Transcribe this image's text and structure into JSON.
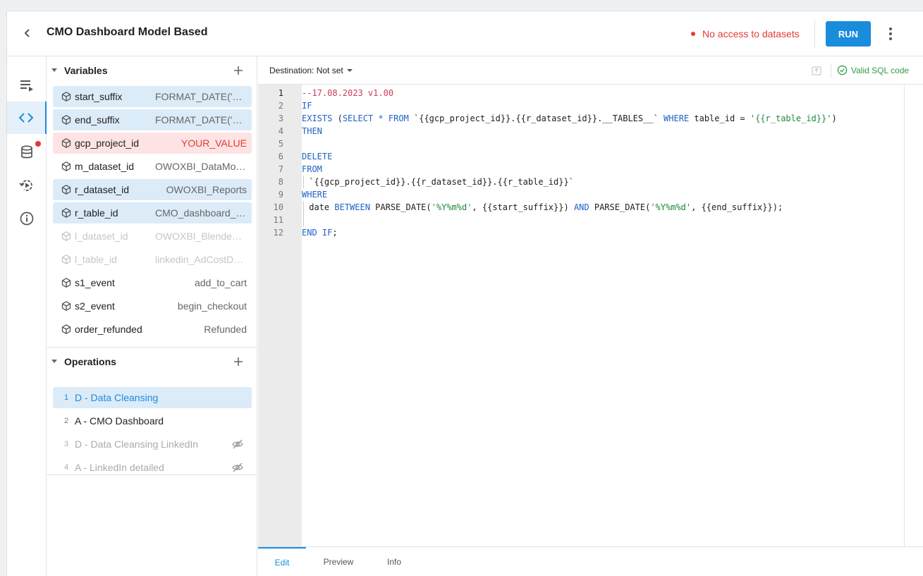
{
  "header": {
    "title": "CMO Dashboard Model Based",
    "status": "No access to datasets",
    "run_label": "RUN"
  },
  "rail": {
    "items": [
      "list-play-icon",
      "code-icon",
      "database-icon",
      "history-icon",
      "info-icon"
    ],
    "active": "code-icon"
  },
  "variables": {
    "title": "Variables",
    "items": [
      {
        "name": "start_suffix",
        "value": "FORMAT_DATE('%Y%m%d', ...",
        "state": "selected"
      },
      {
        "name": "end_suffix",
        "value": "FORMAT_DATE('%Y%m%d', ...",
        "state": "selected"
      },
      {
        "name": "gcp_project_id",
        "value": "YOUR_VALUE",
        "state": "error"
      },
      {
        "name": "m_dataset_id",
        "value": "OWOXBI_DataModel",
        "state": "normal"
      },
      {
        "name": "r_dataset_id",
        "value": "OWOXBI_Reports",
        "state": "selected"
      },
      {
        "name": "r_table_id",
        "value": "CMO_dashboard_model",
        "state": "selected"
      },
      {
        "name": "l_dataset_id",
        "value": "OWOXBI_BlendedData",
        "state": "disabled"
      },
      {
        "name": "l_table_id",
        "value": "linkedin_AdCostData",
        "state": "disabled"
      },
      {
        "name": "s1_event",
        "value": "add_to_cart",
        "state": "normal"
      },
      {
        "name": "s2_event",
        "value": "begin_checkout",
        "state": "normal"
      },
      {
        "name": "order_refunded",
        "value": "Refunded",
        "state": "normal"
      }
    ]
  },
  "operations": {
    "title": "Operations",
    "items": [
      {
        "num": "1",
        "name": "D - Data Cleansing",
        "state": "selected"
      },
      {
        "num": "2",
        "name": "A - CMO Dashboard",
        "state": "normal"
      },
      {
        "num": "3",
        "name": "D - Data Cleansing LinkedIn",
        "state": "disabled"
      },
      {
        "num": "4",
        "name": "A - LinkedIn detailed",
        "state": "disabled"
      }
    ]
  },
  "editor": {
    "destination_label": "Destination: Not set",
    "valid_label": "Valid SQL code",
    "line_numbers": [
      "1",
      "2",
      "3",
      "4",
      "5",
      "6",
      "7",
      "8",
      "9",
      "10",
      "11",
      "12"
    ],
    "code_lines": [
      "--17.08.2023 v1.00",
      "IF",
      "EXISTS (SELECT * FROM `{{gcp_project_id}}.{{r_dataset_id}}.__TABLES__` WHERE table_id = '{{r_table_id}}')",
      "THEN",
      "",
      "DELETE",
      "FROM",
      "  `{{gcp_project_id}}.{{r_dataset_id}}.{{r_table_id}}`",
      "WHERE",
      "  date BETWEEN PARSE_DATE('%Y%m%d', {{start_suffix}}) AND PARSE_DATE('%Y%m%d', {{end_suffix}});",
      "",
      "END IF;"
    ],
    "tabs": [
      "Edit",
      "Preview",
      "Info"
    ],
    "active_tab": "Edit"
  },
  "colors": {
    "accent": "#1a8cdc",
    "error": "#e53935",
    "valid": "#2e9e44",
    "keyword": "#1e62c4",
    "string": "#1f8a3a",
    "comment": "#d0395a"
  }
}
